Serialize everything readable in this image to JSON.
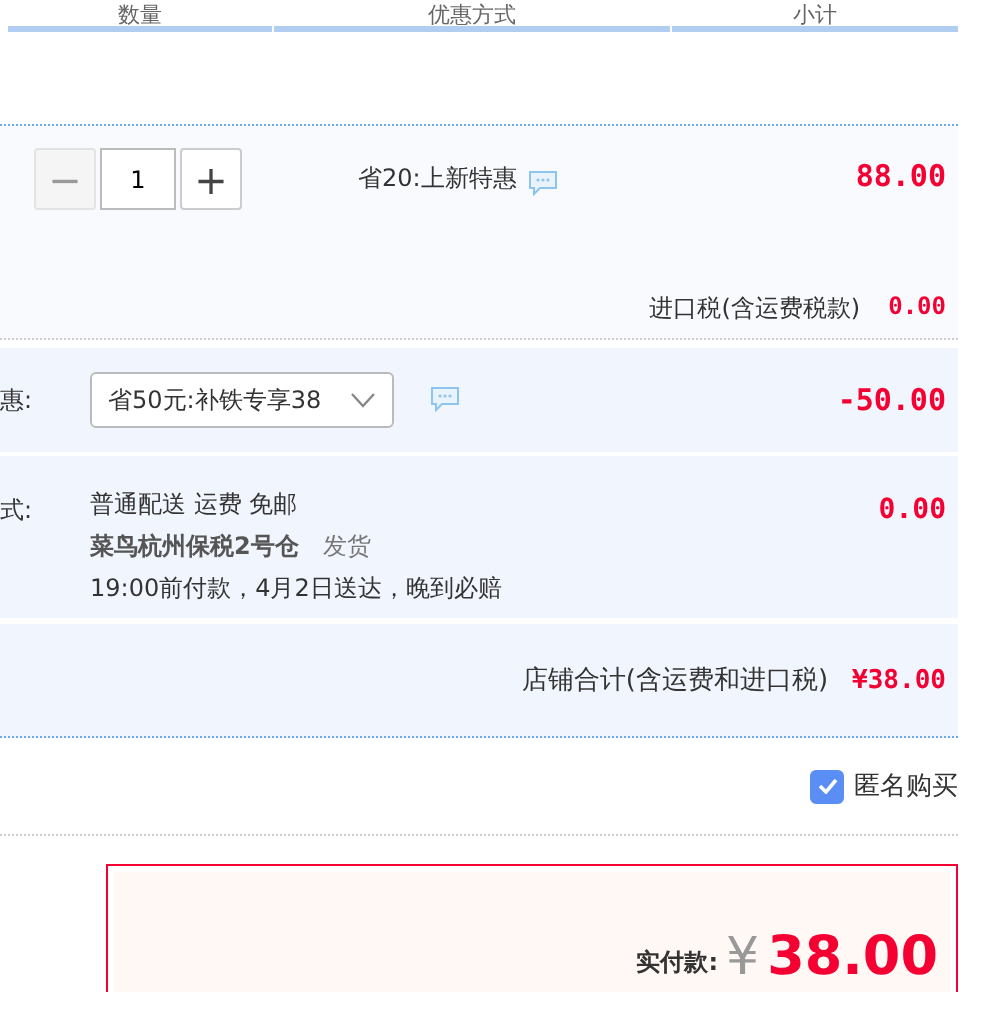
{
  "table_header": [
    "数量",
    "优惠方式",
    "小计"
  ],
  "item": {
    "quantity": {
      "minus": "−",
      "value": "1",
      "plus": "+",
      "minus_disabled": true
    },
    "promotion": "省20:上新特惠",
    "subtotal": "88.00",
    "tax_label": "进口税(含运费税款)",
    "tax": "0.00"
  },
  "discount": {
    "label": "惠:",
    "select": "省50元:补铁专享38",
    "amount": "-50.00"
  },
  "shipping": {
    "label": "式:",
    "method": "普通配送 运费 免邮",
    "warehouse": "菜鸟杭州保税2号仓",
    "dispatch": "发货",
    "promise": "19:00前付款，4月2日送达，晚到必赔",
    "amount": "0.00"
  },
  "store_total": {
    "label": "店铺合计(含运费和进口税)",
    "amount": "¥38.00"
  },
  "anonymous": {
    "label": "匿名购买",
    "checked": true
  },
  "payment": {
    "label": "实付款:",
    "currency": "¥",
    "amount": "38.00"
  }
}
